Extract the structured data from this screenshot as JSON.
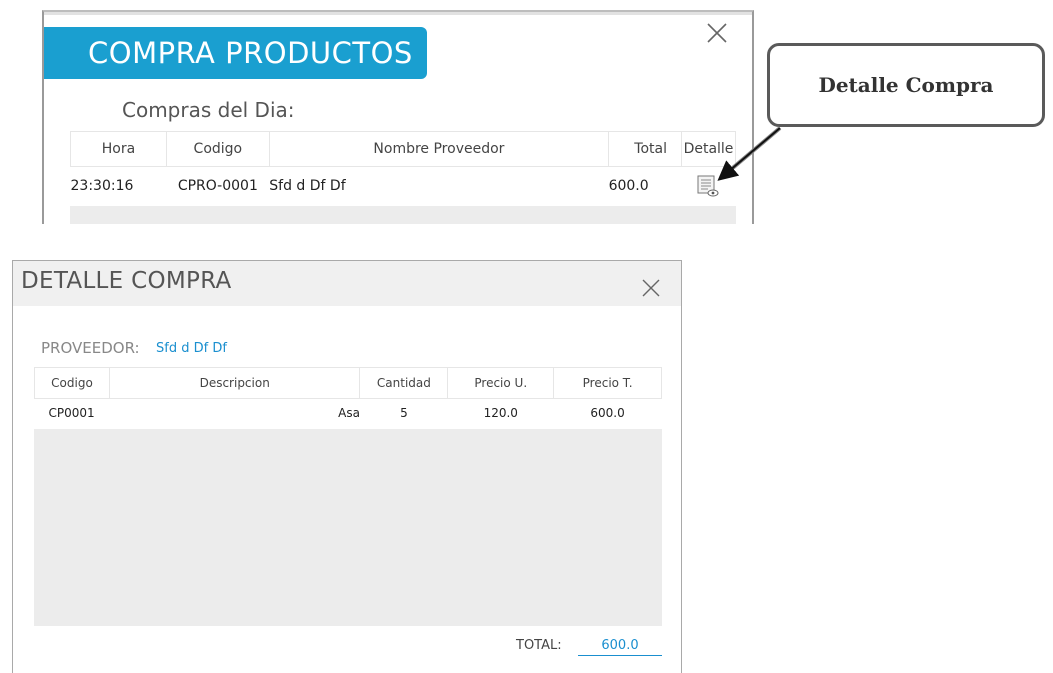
{
  "compra_window": {
    "banner_title": "COMPRA PRODUCTOS",
    "subtitle": "Compras del Dia:",
    "columns": [
      "Hora",
      "Codigo",
      "Nombre Proveedor",
      "Total",
      "Detalle"
    ],
    "rows": [
      {
        "hora": "23:30:16",
        "codigo": "CPRO-0001",
        "proveedor": "Sfd d Df Df",
        "total": "600.0",
        "detalle_icon": "view-detail-icon"
      }
    ]
  },
  "callout": {
    "label": "Detalle Compra"
  },
  "detalle_window": {
    "title": "DETALLE COMPRA",
    "proveedor_label": "PROVEEDOR:",
    "proveedor_value": "Sfd d Df Df",
    "columns": [
      "Codigo",
      "Descripcion",
      "Cantidad",
      "Precio U.",
      "Precio T."
    ],
    "rows": [
      {
        "codigo": "CP0001",
        "descripcion": "Asa",
        "cantidad": "5",
        "precio_u": "120.0",
        "precio_t": "600.0"
      }
    ],
    "total_label": "TOTAL:",
    "total_value": "600.0"
  },
  "colors": {
    "accent": "#1a9fd0",
    "link": "#1a8fcf",
    "table_empty": "#ececec"
  }
}
